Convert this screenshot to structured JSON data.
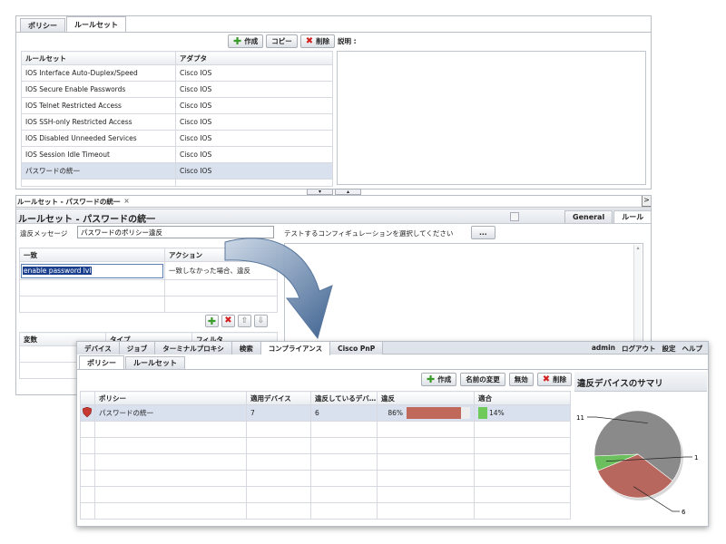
{
  "top": {
    "tabs": [
      "ポリシー",
      "ルールセット"
    ],
    "toolbar": {
      "create": "作成",
      "copy": "コピー",
      "delete": "削除"
    },
    "description_label": "説明 :",
    "columns": [
      "ルールセット",
      "アダプタ"
    ],
    "rows": [
      [
        "IOS Interface Auto-Duplex/Speed",
        "Cisco IOS"
      ],
      [
        "IOS Secure Enable Passwords",
        "Cisco IOS"
      ],
      [
        "IOS Telnet Restricted Access",
        "Cisco IOS"
      ],
      [
        "IOS SSH-only Restricted Access",
        "Cisco IOS"
      ],
      [
        "IOS Disabled Unneeded Services",
        "Cisco IOS"
      ],
      [
        "IOS Session Idle Timeout",
        "Cisco IOS"
      ],
      [
        "パスワードの統一",
        "Cisco IOS"
      ]
    ],
    "selected_row": 6
  },
  "middle": {
    "doc_tab": "ルールセット - パスワードの統一",
    "close": "×",
    "right_arrow": ">",
    "title": "ルールセット - パスワードの統一",
    "view_tabs": [
      "General",
      "ルール"
    ],
    "violation_label": "違反メッセージ",
    "violation_value": "パスワードのポリシー違反",
    "test_label": "テストするコンフィギュレーションを選択してください",
    "test_button": "...",
    "match_columns": [
      "一致",
      "アクション"
    ],
    "match_value": "enable password lvl",
    "action_value": "一致しなかった場合、違反",
    "var_columns": [
      "変数",
      "タイプ",
      "フィルタ"
    ]
  },
  "bottom": {
    "main_tabs": [
      "デバイス",
      "ジョブ",
      "ターミナルプロキシ",
      "検索",
      "コンプライアンス",
      "Cisco PnP"
    ],
    "active_main_tab": 4,
    "user_links": [
      "admin",
      "ログアウト",
      "設定",
      "ヘルプ"
    ],
    "sub_tabs": [
      "ポリシー",
      "ルールセット"
    ],
    "toolbar": {
      "create": "作成",
      "rename": "名前の変更",
      "disable": "無効",
      "delete": "削除"
    },
    "columns": [
      "ポリシー",
      "適用デバイス",
      "違反しているデバ…",
      "違反",
      "適合"
    ],
    "row": {
      "policy": "パスワードの統一",
      "applied": "7",
      "violating": "6",
      "violation_pct": "86%",
      "compliant_pct": "14%",
      "violation_fraction": 0.86,
      "compliant_fraction": 0.14
    },
    "summary_title": "違反デバイスのサマリ"
  },
  "colors": {
    "violation_bar": "#c0685a",
    "compliant_bar": "#6fca5a",
    "pie_gray": "#8a8a8a",
    "pie_red": "#b7675d",
    "pie_green": "#6cbf5d"
  },
  "chart_data": {
    "type": "pie",
    "title": "違反デバイスのサマリ",
    "labels": [
      "11",
      "6",
      "1"
    ],
    "values": [
      11,
      6,
      1
    ]
  }
}
